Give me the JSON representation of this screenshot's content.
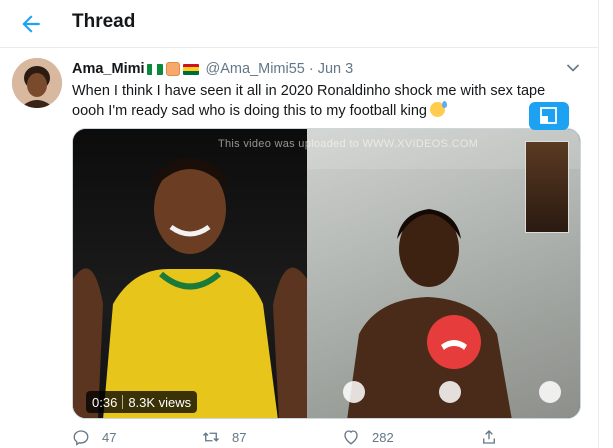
{
  "header": {
    "title": "Thread",
    "accent": "#1da1f2"
  },
  "tweet": {
    "display_name": "Ama_Mimi",
    "handle": "@Ama_Mimi55",
    "separator": "·",
    "date": "Jun 3",
    "text_line_1": "When I think I have seen it all in 2020 Ronaldinho shock me with sex tape",
    "text_line_2": "oooh I'm ready sad who is doing this to my football king",
    "name_emojis": [
      "flag-nigeria",
      "hand-emoji",
      "flag-ghana"
    ],
    "text_emoji": "sweat-smile-emoji"
  },
  "video": {
    "watermark": "This video was uploaded to WWW.XVIDEOS.COM",
    "duration": "0:36",
    "views": "8.3K views"
  },
  "actions": {
    "reply_count": "47",
    "retweet_count": "87",
    "like_count": "282"
  },
  "icons": {
    "back": "back-arrow-icon",
    "caret": "chevron-down-icon",
    "reply": "reply-icon",
    "retweet": "retweet-icon",
    "like": "heart-icon",
    "share": "share-icon"
  }
}
